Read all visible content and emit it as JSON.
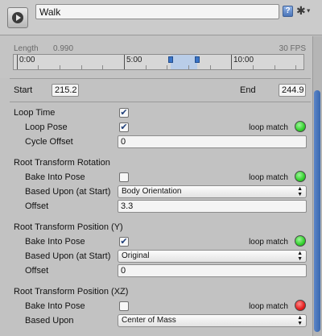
{
  "header": {
    "clip_name": "Walk",
    "clip_icon": "animation-clip-icon",
    "help_icon": "help-icon",
    "gear_icon": "gear-icon",
    "help_glyph": "?",
    "gear_glyph": "✱"
  },
  "timeline": {
    "length_label": "Length",
    "length_value": "0.990",
    "fps_label": "30 FPS",
    "tick_labels": [
      "0:00",
      "5:00",
      "10:00"
    ]
  },
  "range": {
    "start_label": "Start",
    "start_value": "215.2",
    "end_label": "End",
    "end_value": "244.9"
  },
  "loop": {
    "loop_time_label": "Loop Time",
    "loop_time_checked": true,
    "loop_pose_label": "Loop Pose",
    "loop_pose_checked": true,
    "loop_pose_match_label": "loop match",
    "loop_pose_match_status": "green",
    "cycle_offset_label": "Cycle Offset",
    "cycle_offset_value": "0"
  },
  "rotation": {
    "title": "Root Transform Rotation",
    "bake_label": "Bake Into Pose",
    "bake_checked": false,
    "match_label": "loop match",
    "match_status": "green",
    "based_upon_label": "Based Upon (at Start)",
    "based_upon_value": "Body Orientation",
    "offset_label": "Offset",
    "offset_value": "3.3"
  },
  "position_y": {
    "title": "Root Transform Position (Y)",
    "bake_label": "Bake Into Pose",
    "bake_checked": true,
    "match_label": "loop match",
    "match_status": "green",
    "based_upon_label": "Based Upon (at Start)",
    "based_upon_value": "Original",
    "offset_label": "Offset",
    "offset_value": "0"
  },
  "position_xz": {
    "title": "Root Transform Position (XZ)",
    "bake_label": "Bake Into Pose",
    "bake_checked": false,
    "match_label": "loop match",
    "match_status": "red",
    "based_upon_label": "Based Upon",
    "based_upon_value": "Center of Mass"
  },
  "glyphs": {
    "check": "✔",
    "dropdown_arrows": "▲▼"
  },
  "colors": {
    "status_green": "#32d12d",
    "status_red": "#e61e1e",
    "selection_blue": "#3a74c7"
  }
}
